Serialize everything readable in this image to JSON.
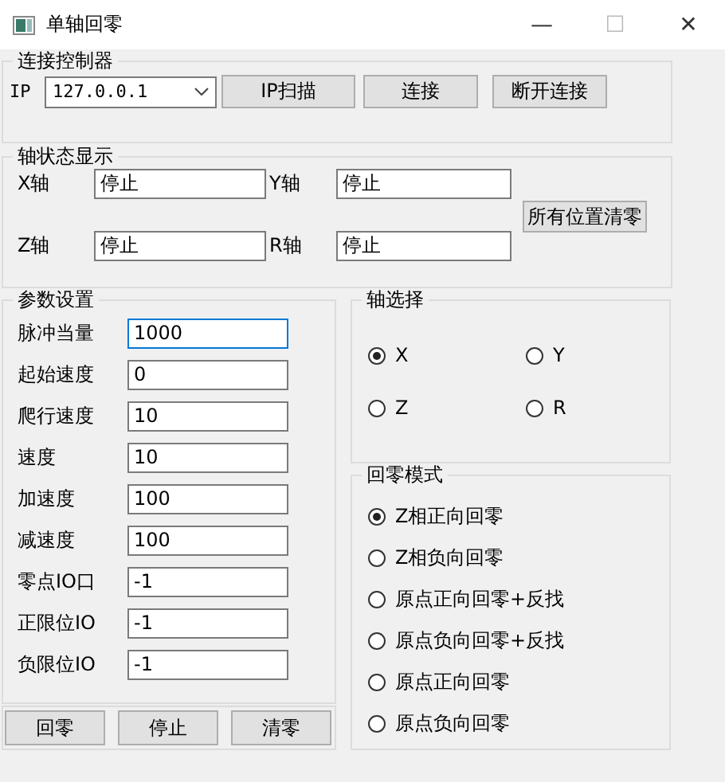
{
  "window": {
    "title": "单轴回零",
    "controls": [
      "—",
      "☐",
      "✕"
    ]
  },
  "connect": {
    "title": "连接控制器",
    "ip_label": "IP",
    "ip_value": "127.0.0.1",
    "buttons": [
      "IP扫描",
      "连接",
      "断开连接"
    ]
  },
  "axis_status": {
    "title": "轴状态显示",
    "axes": [
      {
        "label": "X轴",
        "value": "停止"
      },
      {
        "label": "Y轴",
        "value": "停止"
      },
      {
        "label": "Z轴",
        "value": "停止"
      },
      {
        "label": "R轴",
        "value": "停止"
      }
    ],
    "clear_button": "所有位置清零"
  },
  "params": {
    "title": "参数设置",
    "fields": [
      {
        "label": "脉冲当量",
        "value": "1000",
        "focused": true
      },
      {
        "label": "起始速度",
        "value": "0",
        "focused": false
      },
      {
        "label": "爬行速度",
        "value": "10",
        "focused": false
      },
      {
        "label": "速度",
        "value": "10",
        "focused": false
      },
      {
        "label": "加速度",
        "value": "100",
        "focused": false
      },
      {
        "label": "减速度",
        "value": "100",
        "focused": false
      },
      {
        "label": "零点IO口",
        "value": "-1",
        "focused": false
      },
      {
        "label": "正限位IO",
        "value": "-1",
        "focused": false
      },
      {
        "label": "负限位IO",
        "value": "-1",
        "focused": false
      }
    ]
  },
  "buttons": [
    "回零",
    "停止",
    "清零"
  ],
  "axis_select": {
    "title": "轴选择",
    "options": [
      {
        "label": "X",
        "selected": true
      },
      {
        "label": "Y",
        "selected": false
      },
      {
        "label": "Z",
        "selected": false
      },
      {
        "label": "R",
        "selected": false
      }
    ]
  },
  "home_mode": {
    "title": "回零模式",
    "options": [
      {
        "label": "Z相正向回零",
        "selected": true
      },
      {
        "label": "Z相负向回零",
        "selected": false
      },
      {
        "label": "原点正向回零+反找",
        "selected": false
      },
      {
        "label": "原点负向回零+反找",
        "selected": false
      },
      {
        "label": "原点正向回零",
        "selected": false
      },
      {
        "label": "原点负向回零",
        "selected": false
      }
    ]
  }
}
